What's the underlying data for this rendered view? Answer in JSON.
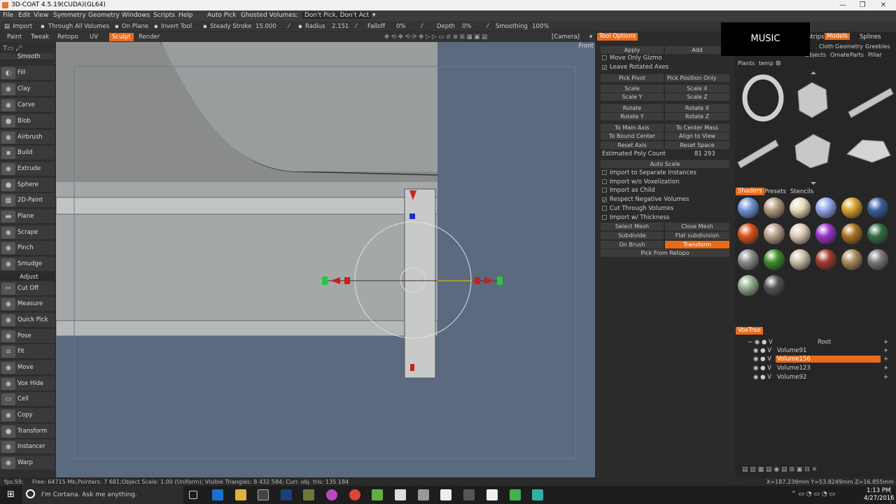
{
  "window": {
    "title": "3D-COAT 4.5.19(CUDA)(GL64)"
  },
  "menu": [
    "File",
    "Edit",
    "View",
    "Symmetry",
    "Geometry",
    "Windows",
    "Scripts",
    "Help"
  ],
  "toolbar": {
    "auto_pick": "Auto Pick",
    "ghosted": "Ghosted Volumes:",
    "ghost_mode": "Don't Pick, Don't Act",
    "import": "Import",
    "through_all": "Through All Volumes",
    "on_plane": "On Plane",
    "invert_tool": "Invert Tool",
    "steady_stroke": "Steady Stroke",
    "steady_value": "15.000",
    "radius_label": "Radius",
    "radius_value": "2.151",
    "falloff_label": "Falloff",
    "falloff_value": "0%",
    "depth_label": "Depth",
    "depth_value": "0%",
    "smoothing_label": "Smoothing",
    "smoothing_value": "100%"
  },
  "rooms": [
    "Paint",
    "Tweak",
    "Retopo",
    "UV",
    "Sculpt",
    "Render"
  ],
  "active_room": "Sculpt",
  "camera": "[Camera]",
  "front_label": "Front",
  "tools": [
    "Smooth",
    "Fill",
    "Clay",
    "Carve",
    "Blob",
    "Airbrush",
    "Build",
    "Extrude",
    "Sphere",
    "2D-Paint",
    "Plane",
    "Scrape",
    "Pinch",
    "Smudge",
    "Adjust",
    "Cut Off",
    "Measure",
    "Quick Pick",
    "Pose",
    "Fit",
    "Move",
    "Vox Hide",
    "Cell",
    "Copy",
    "Transform",
    "Instancer",
    "Warp"
  ],
  "tool_options": {
    "header": "Tool Options",
    "apply": "Apply",
    "add": "Add",
    "move_only_gizmo": "Move Only Gizmo",
    "leave_rotated_axes": "Leave Rotated Axes",
    "pick_pivot": "Pick Pivot",
    "pick_position_only": "Pick Position Only",
    "scale": "Scale",
    "scale_x": "Scale X",
    "scale_y": "Scale Y",
    "scale_z": "Scale Z",
    "rotate": "Rotate",
    "rotate_x": "Rotate X",
    "rotate_y": "Rotate Y",
    "rotate_z": "Rotate Z",
    "to_main_axis": "To Main Axis",
    "to_center_mass": "To Center Mass",
    "to_bound_center": "To Bound Center",
    "align_to_view": "Align to View",
    "reset_axis": "Reset Axis",
    "reset_space": "Reset Space",
    "est_poly_label": "Estimated Poly Count",
    "est_poly_value": "81 293",
    "auto_scale": "Auto Scale",
    "import_separate": "Import to Separate Instances",
    "import_wo_vox": "Import w/o Voxelization",
    "import_as_child": "Import as Child",
    "respect_negative": "Respect Negative Volumes",
    "cut_through": "Cut Through Volumes",
    "import_thickness": "Import w/ Thickness",
    "select_mesh": "Select Mesh",
    "close_mesh": "Close Mesh",
    "subdivide": "Subdivide",
    "flat_subdivision": "Flat subdivision",
    "on_brush": "On Brush",
    "transform": "Transform",
    "pick_from_retopo": "Pick From Retopo"
  },
  "overlay_music": "MUSIC",
  "model_tabs": [
    "Strips",
    "Models",
    "Splines"
  ],
  "model_subtabs": [
    "Cloth",
    "Geometry",
    "Greebles",
    "Objects",
    "Ornate",
    "Parts",
    "Pillar",
    "Plants",
    "temp"
  ],
  "shader_tabs": [
    "Shaders",
    "Presets",
    "Stencils"
  ],
  "shader_colors": [
    "#6f93d8",
    "#b59a7e",
    "#e8dcb8",
    "#8fa6e8",
    "#d7a22a",
    "#3a5f9e",
    "#d9531a",
    "#b79f8a",
    "#e0cab5",
    "#9a36c9",
    "#a8741f",
    "#356e44",
    "#8c8c8c",
    "#3f8f2a",
    "#c7c0a8",
    "#a33b2f",
    "#a88a5c",
    "#7a7a7a",
    "#8fae8a",
    "#555555"
  ],
  "voxtree": {
    "header": "VoxTree",
    "root": "Root",
    "items": [
      "Volume91",
      "Volume156",
      "Volume123",
      "Volume92"
    ],
    "selected": "Volume156"
  },
  "status": {
    "fps": "fps:59;",
    "info": "Free: 64715 Mb,Pointers: 7 681;Object Scale: 1.00 (Uniform); Visible Triangles: 8 432 584; Curr. obj. tris: 135 184",
    "coords": "X=187.239mm Y=53.8249mm Z=16.855mm"
  },
  "taskbar": {
    "cortana": "I'm Cortana. Ask me anything.",
    "time": "1:13 PM",
    "date": "4/27/2016"
  }
}
